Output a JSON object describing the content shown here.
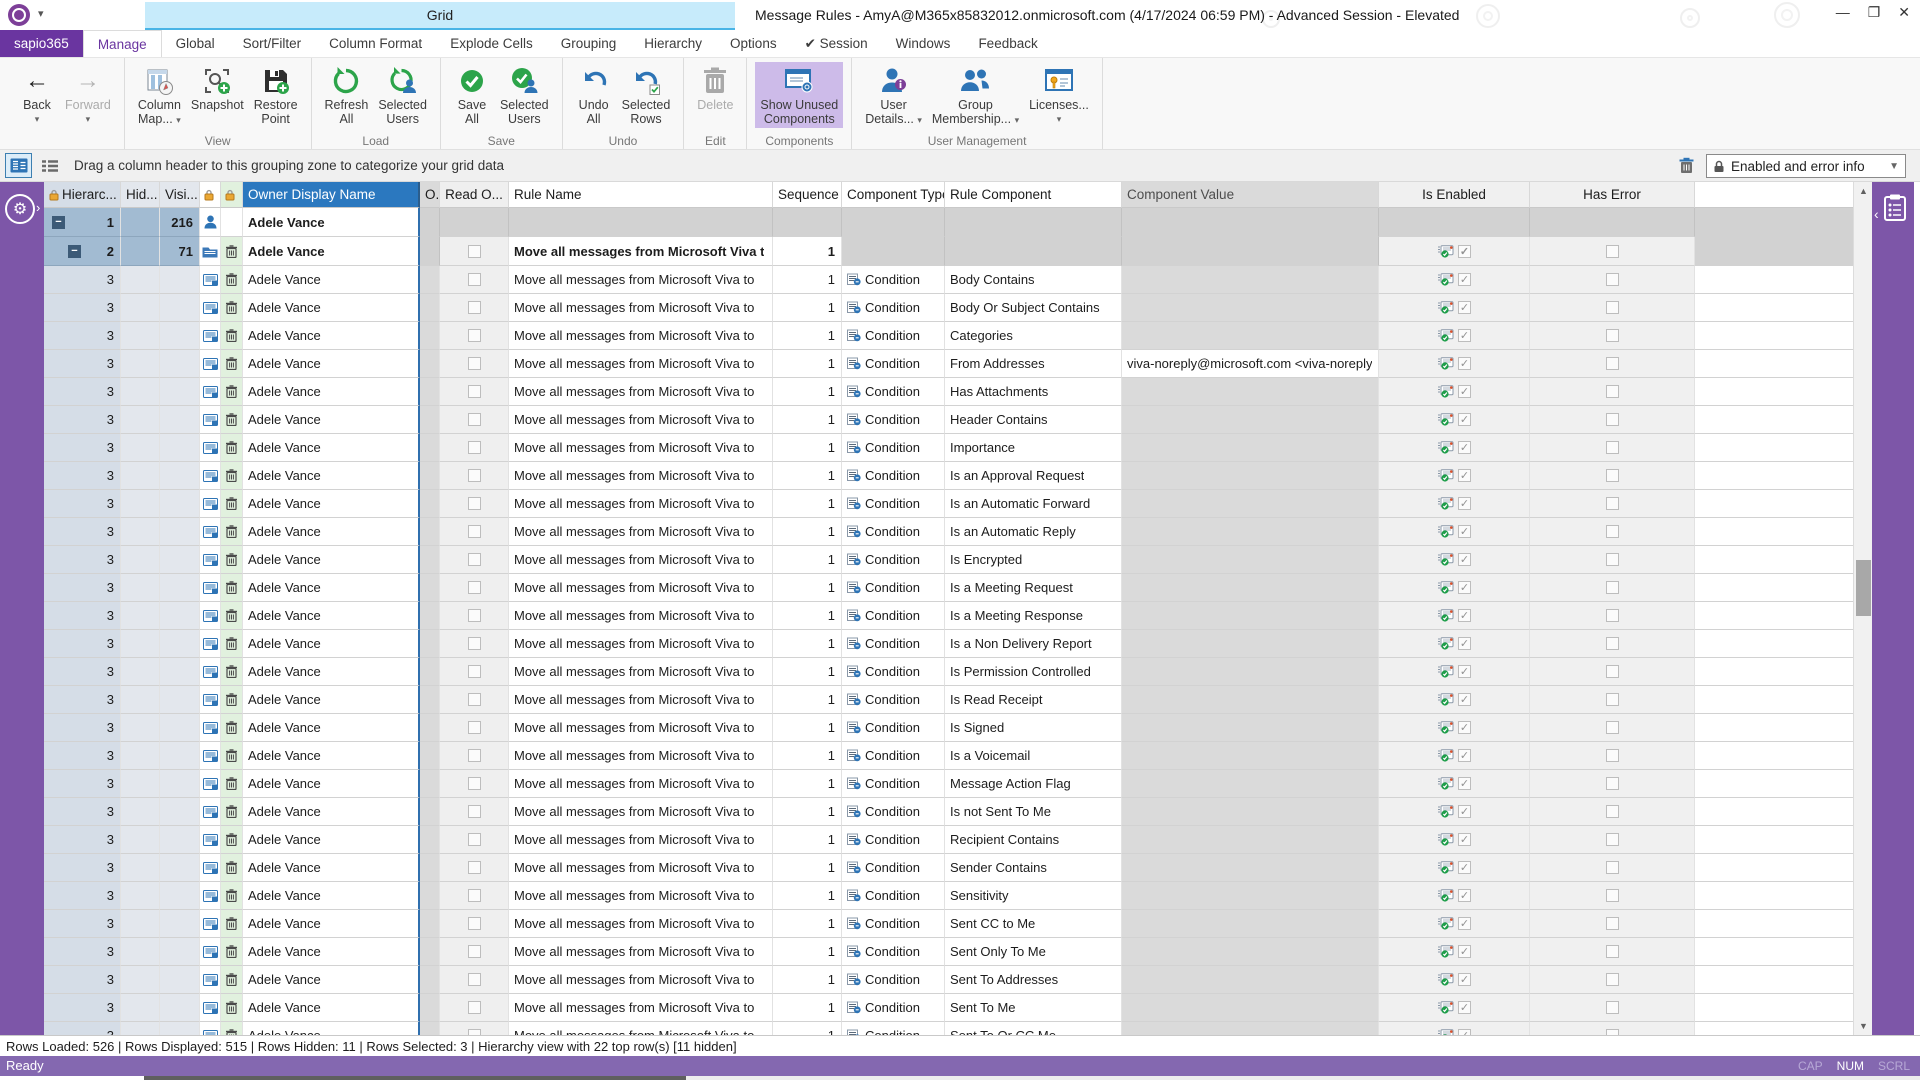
{
  "titlebar": {
    "title": "Message Rules - AmyA@M365x85832012.onmicrosoft.com (4/17/2024 06:59 PM) - Advanced Session - Elevated",
    "contextual_tab": "Grid",
    "window_controls": {
      "minimize": "—",
      "restore": "❐",
      "close": "✕",
      "collapse_ribbon": "^",
      "help": "?"
    }
  },
  "tabs": {
    "app": "sapio365",
    "items": [
      {
        "label": "Manage",
        "active": true
      },
      {
        "label": "Global"
      },
      {
        "label": "Sort/Filter"
      },
      {
        "label": "Column Format"
      },
      {
        "label": "Explode Cells"
      },
      {
        "label": "Grouping"
      },
      {
        "label": "Hierarchy"
      },
      {
        "label": "Options"
      },
      {
        "label": "Session",
        "check": true
      },
      {
        "label": "Windows"
      },
      {
        "label": "Feedback"
      }
    ]
  },
  "ribbon": {
    "groups": [
      {
        "label": "",
        "buttons": [
          {
            "icon": "back",
            "lines": [
              "Back"
            ],
            "caret": "below"
          },
          {
            "icon": "forward",
            "lines": [
              "Forward"
            ],
            "caret": "below",
            "disabled": true
          }
        ]
      },
      {
        "label": "View",
        "buttons": [
          {
            "icon": "column-map",
            "lines": [
              "Column",
              "Map..."
            ],
            "caret": "inline"
          },
          {
            "icon": "snapshot",
            "lines": [
              "Snapshot"
            ]
          },
          {
            "icon": "restore-point",
            "lines": [
              "Restore",
              "Point"
            ]
          }
        ]
      },
      {
        "label": "Load",
        "buttons": [
          {
            "icon": "refresh-all",
            "lines": [
              "Refresh",
              "All"
            ]
          },
          {
            "icon": "refresh-selected",
            "lines": [
              "Selected",
              "Users"
            ]
          }
        ]
      },
      {
        "label": "Save",
        "buttons": [
          {
            "icon": "save-all",
            "lines": [
              "Save",
              "All"
            ]
          },
          {
            "icon": "save-selected",
            "lines": [
              "Selected",
              "Users"
            ]
          }
        ]
      },
      {
        "label": "Undo",
        "buttons": [
          {
            "icon": "undo-all",
            "lines": [
              "Undo",
              "All"
            ]
          },
          {
            "icon": "undo-selected",
            "lines": [
              "Selected",
              "Rows"
            ]
          }
        ]
      },
      {
        "label": "Edit",
        "buttons": [
          {
            "icon": "delete",
            "lines": [
              "Delete"
            ],
            "disabled": true
          }
        ]
      },
      {
        "label": "Components",
        "buttons": [
          {
            "icon": "show-unused",
            "lines": [
              "Show Unused",
              "Components"
            ],
            "active": true
          }
        ]
      },
      {
        "label": "User Management",
        "buttons": [
          {
            "icon": "user-details",
            "lines": [
              "User",
              "Details..."
            ],
            "caret": "inline"
          },
          {
            "icon": "group-membership",
            "lines": [
              "Group",
              "Membership..."
            ],
            "caret": "inline"
          },
          {
            "icon": "licenses",
            "lines": [
              "Licenses..."
            ],
            "caret": "below"
          }
        ]
      }
    ]
  },
  "grouping_bar": {
    "text": "Drag a column header to this grouping zone to categorize your grid data",
    "filter_label": "Enabled and error info"
  },
  "grid": {
    "columns": [
      {
        "label": "Hierarc...",
        "lock": true
      },
      {
        "label": "Hid..."
      },
      {
        "label": "Visi..."
      },
      {
        "label": "",
        "lock": true
      },
      {
        "label": "",
        "lock": true
      },
      {
        "label": "Owner Display Name",
        "selected": true
      },
      {
        "label": "O..."
      },
      {
        "label": "Read O..."
      },
      {
        "label": "Rule Name"
      },
      {
        "label": "Sequence"
      },
      {
        "label": "Component Type"
      },
      {
        "label": "Rule Component"
      },
      {
        "label": "Component Value"
      },
      {
        "label": "Is Enabled"
      },
      {
        "label": "Has Error"
      },
      {
        "label": ""
      }
    ],
    "group_rows": [
      {
        "hier": "1",
        "visible": "216",
        "owner": "Adele Vance"
      },
      {
        "hier": "2",
        "visible": "71",
        "owner": "Adele Vance",
        "rule": "Move all messages from Microsoft Viva t",
        "seq": "1"
      }
    ],
    "row_defaults": {
      "hier": "3",
      "owner": "Adele Vance",
      "rule": "Move all messages from Microsoft Viva to",
      "seq": "1",
      "type": "Condition"
    },
    "rows": [
      {
        "component": "Body Contains"
      },
      {
        "component": "Body Or Subject Contains"
      },
      {
        "component": "Categories"
      },
      {
        "component": "From Addresses",
        "value": "viva-noreply@microsoft.com <viva-noreply"
      },
      {
        "component": "Has Attachments"
      },
      {
        "component": "Header Contains"
      },
      {
        "component": "Importance"
      },
      {
        "component": "Is an Approval Request"
      },
      {
        "component": "Is an Automatic Forward"
      },
      {
        "component": "Is an Automatic Reply"
      },
      {
        "component": "Is Encrypted"
      },
      {
        "component": "Is a Meeting Request"
      },
      {
        "component": "Is a Meeting Response"
      },
      {
        "component": "Is a Non Delivery Report"
      },
      {
        "component": "Is Permission Controlled"
      },
      {
        "component": "Is Read Receipt"
      },
      {
        "component": "Is Signed"
      },
      {
        "component": "Is a Voicemail"
      },
      {
        "component": "Message Action Flag"
      },
      {
        "component": "Is not Sent To Me"
      },
      {
        "component": "Recipient Contains"
      },
      {
        "component": "Sender Contains"
      },
      {
        "component": "Sensitivity"
      },
      {
        "component": "Sent CC to Me"
      },
      {
        "component": "Sent Only To Me"
      },
      {
        "component": "Sent To Addresses"
      },
      {
        "component": "Sent To Me"
      },
      {
        "component": "Sent To Or CC Me"
      }
    ]
  },
  "status": {
    "info": "Rows Loaded: 526 | Rows Displayed: 515 | Rows Hidden: 11 | Rows Selected: 3 | Hierarchy view with 22 top row(s) [11 hidden]",
    "ready": "Ready",
    "cap": "CAP",
    "num": "NUM",
    "scrl": "SCRL"
  },
  "colors": {
    "accent_purple": "#7d56a8",
    "app_tab_purple": "#6a35a0",
    "contextual_tab_blue": "#c7ebfb",
    "selected_header_blue": "#2b78bf",
    "group_row_blue": "#a2bbd2",
    "ready_bar_purple": "#8468b0",
    "trash_cell_green": "#e1f1de",
    "enabled_green": "#1e9e4a"
  }
}
